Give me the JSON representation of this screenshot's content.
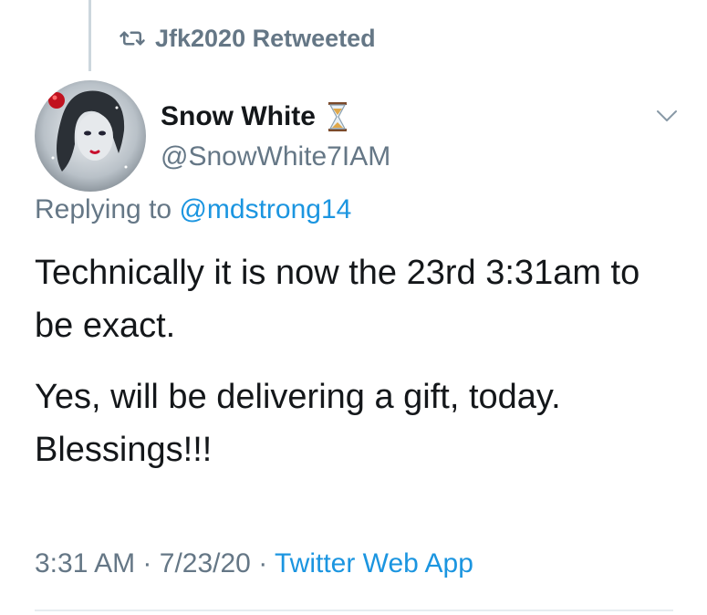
{
  "retweet": {
    "icon": "retweet-icon",
    "label": "Jfk2020 Retweeted"
  },
  "author": {
    "display_name": "Snow White",
    "name_emoji": "hourglass-icon",
    "handle": "@SnowWhite7IAM",
    "avatar": "avatar"
  },
  "menu": {
    "icon": "chevron-down-icon"
  },
  "reply": {
    "prefix": "Replying to",
    "mention": "@mdstrong14"
  },
  "tweet": {
    "paragraphs": [
      "Technically it is now the 23rd 3:31am to be exact.",
      "Yes, will be delivering a gift, today. Blessings!!!"
    ]
  },
  "meta": {
    "time": "3:31 AM",
    "date": "7/23/20",
    "separator": "·",
    "source": "Twitter Web App"
  },
  "colors": {
    "text": "#14171a",
    "muted": "#657786",
    "link": "#1b95e0",
    "divider": "#e6ecf0"
  }
}
